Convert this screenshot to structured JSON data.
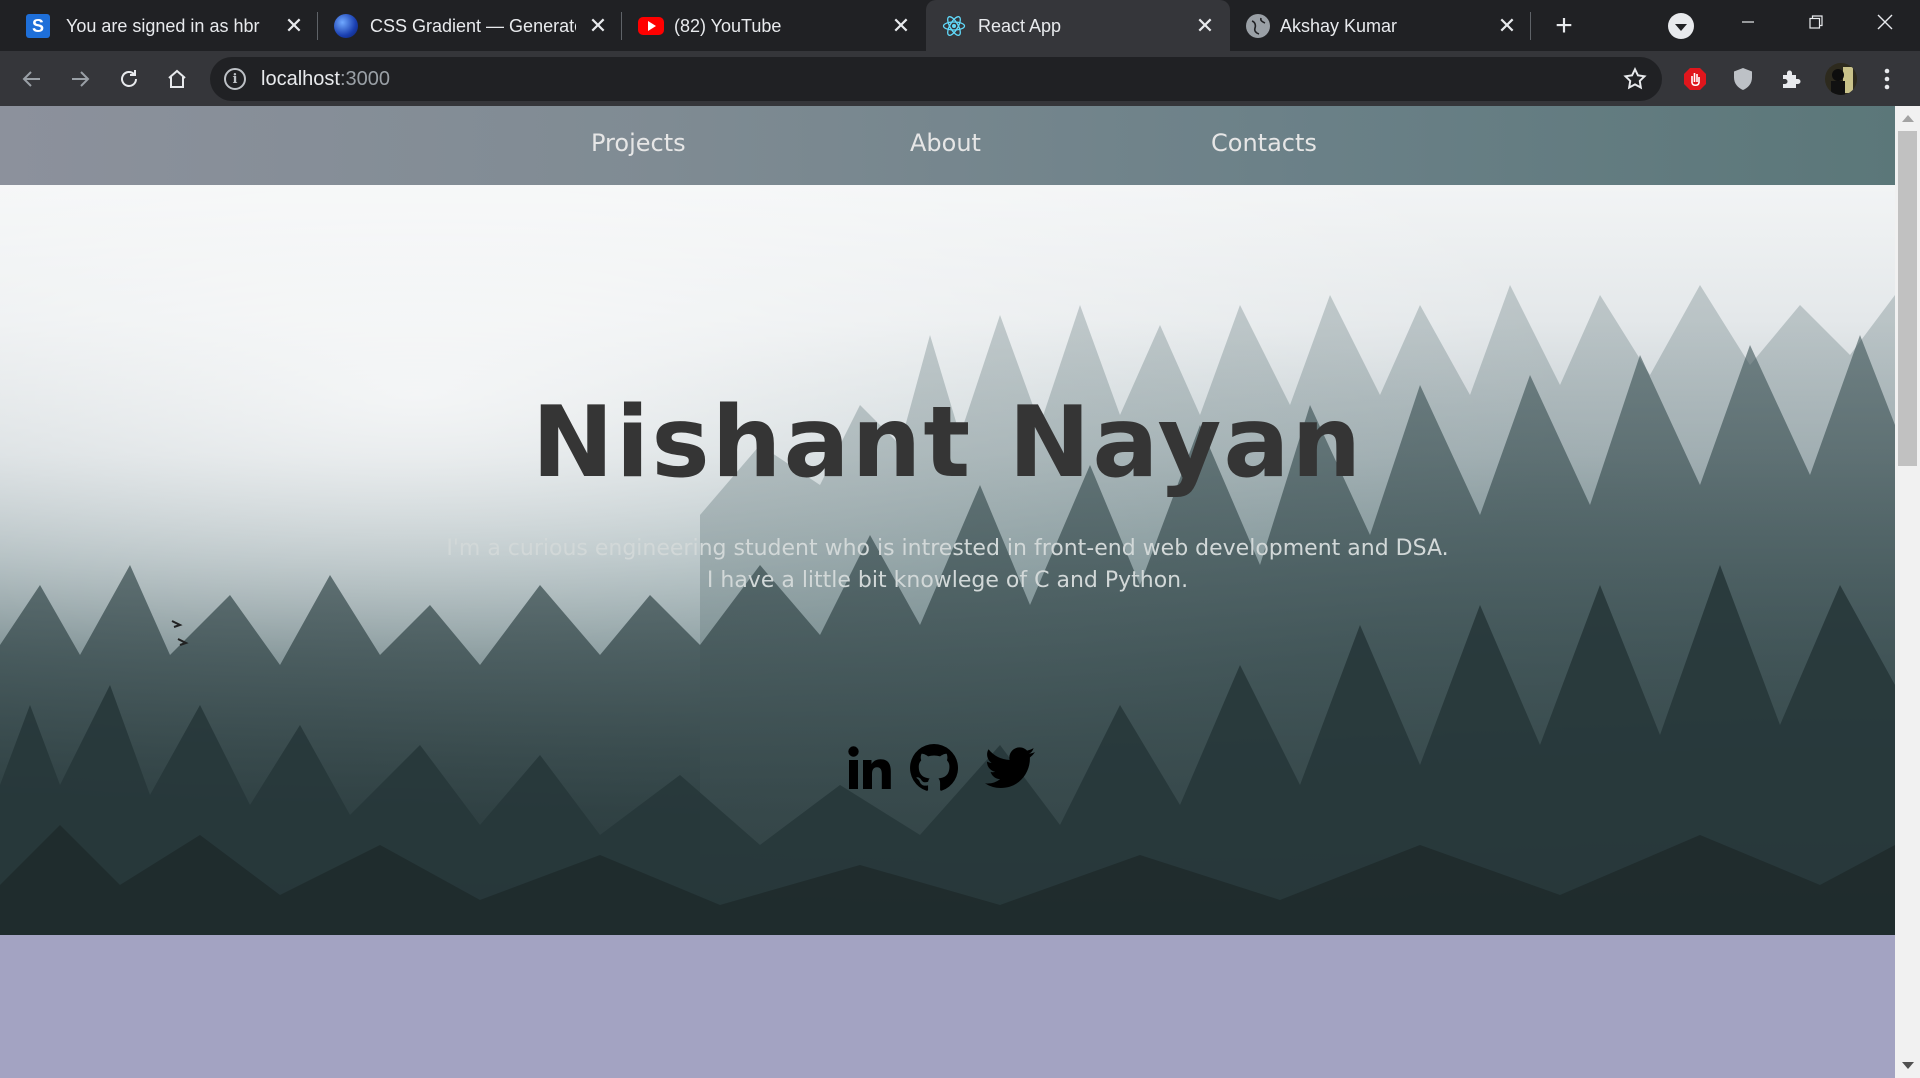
{
  "browser": {
    "tabs": [
      {
        "title": "You are signed in as hbr",
        "favicon": "s-logo-icon"
      },
      {
        "title": "CSS Gradient — Generator, Maker",
        "favicon": "gradient-globe-icon"
      },
      {
        "title": "(82) YouTube",
        "favicon": "youtube-icon"
      },
      {
        "title": "React App",
        "favicon": "react-icon"
      },
      {
        "title": "Akshay Kumar",
        "favicon": "globe-icon"
      }
    ],
    "active_tab_index": 3,
    "address": {
      "host": "localhost",
      "port": ":3000"
    }
  },
  "page": {
    "nav": [
      "Projects",
      "About",
      "Contacts"
    ],
    "hero": {
      "name": "Nishant Nayan",
      "line1": "I'm a curious engineering student who is intrested in front-end web development and DSA.",
      "line2": "I have a little bit knowlege of C and Python."
    },
    "social": [
      "linkedin-icon",
      "github-icon",
      "twitter-icon"
    ],
    "colors": {
      "lower_background": "#a3a3c2",
      "nav_text": "#e6e6e6",
      "title": "#353535"
    }
  }
}
